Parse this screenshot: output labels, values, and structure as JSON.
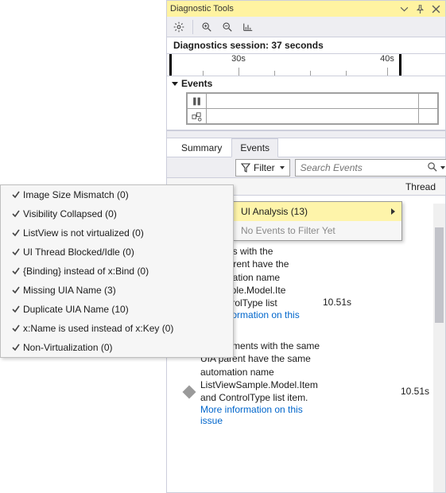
{
  "window": {
    "title": "Diagnostic Tools"
  },
  "session": {
    "label": "Diagnostics session: 37 seconds"
  },
  "timeline": {
    "tick1": "30s",
    "tick2": "40s"
  },
  "events_pane": {
    "title": "Events"
  },
  "tabs": {
    "summary": "Summary",
    "events": "Events"
  },
  "filter": {
    "label": "Filter",
    "search_placeholder": "Search Events"
  },
  "filter_menu": {
    "ui_analysis": "UI Analysis (13)",
    "no_events": "No Events to Filter Yet"
  },
  "list": {
    "thread_col": "Thread"
  },
  "partial": {
    "l1": "ControlType list",
    "time1": "10.51s",
    "link1": "formation on this",
    "l2a": "ments with the",
    "l2b": "IA parent have the",
    "l2c": "utomation name",
    "l2d": "Sample.Model.Ite",
    "l2e": "ControlType list",
    "time2": "10.51s",
    "link2_a": "More information on this",
    "link2_b": "issue"
  },
  "issue3": {
    "text": "UIA Elements with the same UIA parent have the same automation name ListViewSample.Model.Item and ControlType list item.",
    "time": "10.51s",
    "link_a": "More information on this",
    "link_b": "issue"
  },
  "submenu": {
    "items": [
      {
        "label": "Image Size Mismatch (0)"
      },
      {
        "label": "Visibility Collapsed (0)"
      },
      {
        "label": "ListView is not virtualized (0)"
      },
      {
        "label": "UI Thread Blocked/Idle (0)"
      },
      {
        "label": "{Binding} instead of x:Bind (0)"
      },
      {
        "label": "Missing UIA Name (3)"
      },
      {
        "label": "Duplicate UIA Name (10)"
      },
      {
        "label": "x:Name is used instead of x:Key (0)"
      },
      {
        "label": "Non-Virtualization (0)"
      }
    ]
  }
}
